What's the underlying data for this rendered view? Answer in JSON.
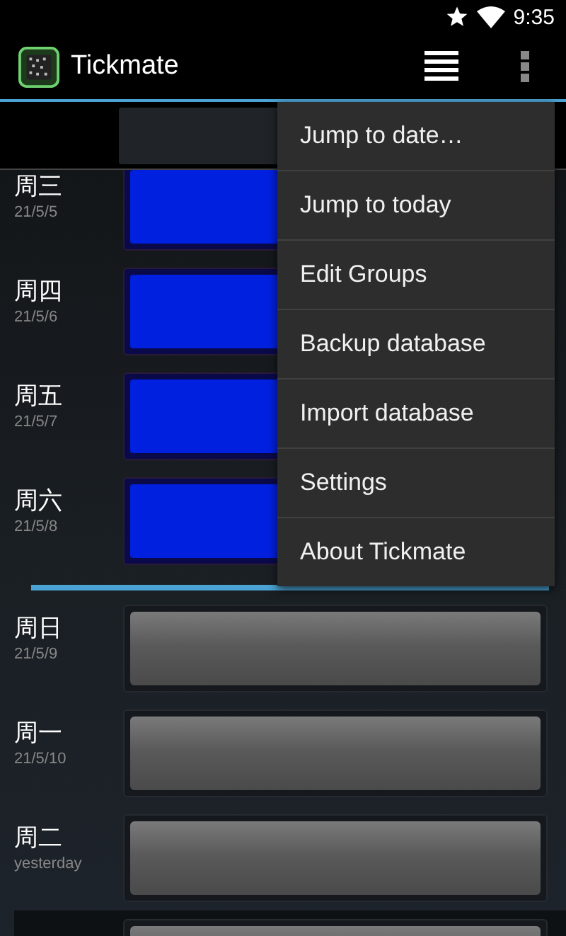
{
  "status_bar": {
    "time": "9:35"
  },
  "action_bar": {
    "title": "Tickmate"
  },
  "rows": [
    {
      "kind": "day",
      "day": "周三",
      "date": "21/5/5",
      "ticked": true
    },
    {
      "kind": "day",
      "day": "周四",
      "date": "21/5/6",
      "ticked": true
    },
    {
      "kind": "day",
      "day": "周五",
      "date": "21/5/7",
      "ticked": true
    },
    {
      "kind": "day",
      "day": "周六",
      "date": "21/5/8",
      "ticked": true
    },
    {
      "kind": "divider"
    },
    {
      "kind": "day",
      "day": "周日",
      "date": "21/5/9",
      "ticked": false
    },
    {
      "kind": "day",
      "day": "周一",
      "date": "21/5/10",
      "ticked": false
    },
    {
      "kind": "day",
      "day": "周二",
      "date": "yesterday",
      "ticked": false
    },
    {
      "kind": "day",
      "ticked": false,
      "today": true
    }
  ],
  "menu": {
    "items": [
      {
        "label": "Jump to date…"
      },
      {
        "label": "Jump to today"
      },
      {
        "label": "Edit Groups"
      },
      {
        "label": "Backup database"
      },
      {
        "label": "Import database"
      },
      {
        "label": "Settings"
      },
      {
        "label": "About Tickmate"
      }
    ]
  }
}
